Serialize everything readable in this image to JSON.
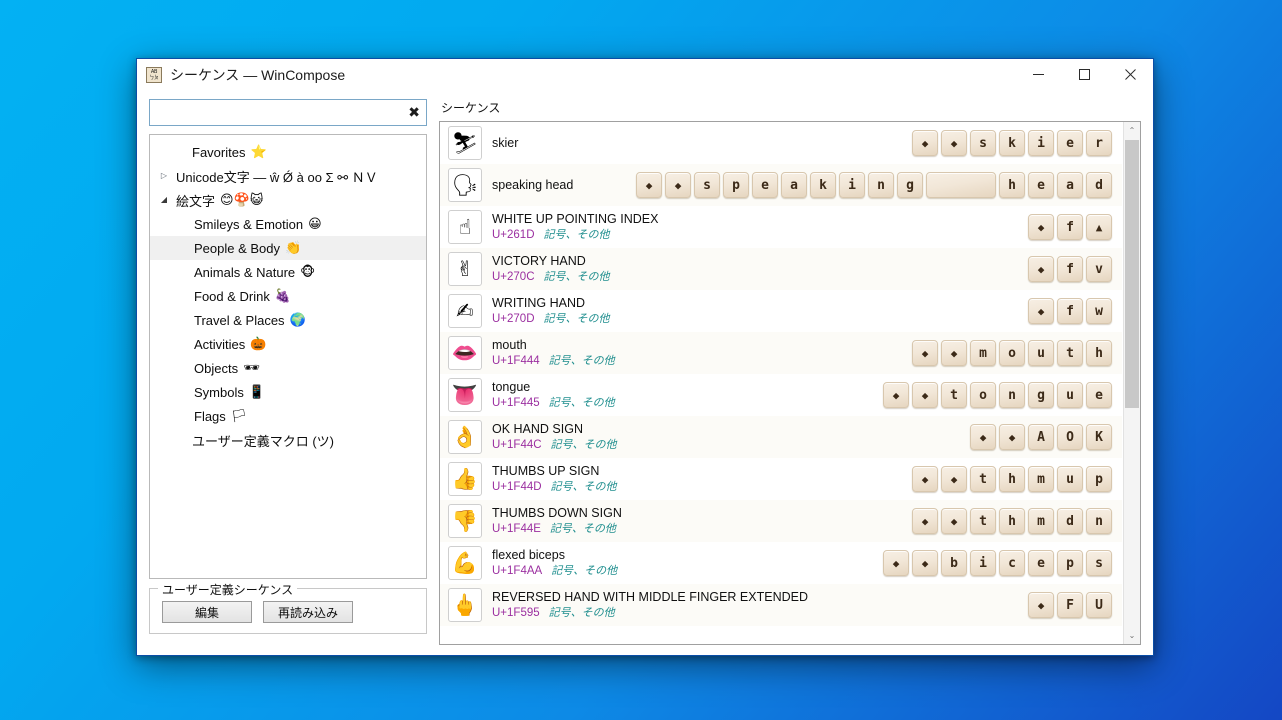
{
  "window": {
    "title": "シーケンス — WinCompose",
    "icon": "app-icon",
    "minimize_label": "—",
    "maximize_label": "☐",
    "close_label": "✕"
  },
  "search": {
    "value": "",
    "placeholder": "",
    "clear_label": "✖"
  },
  "tree": {
    "nodes": [
      {
        "label": "Favorites",
        "emoji": "⭐",
        "twisty": "",
        "indent": "lvl1b",
        "selected": false
      },
      {
        "label": "Unicode文字 — ŵ Ǿ à ᴏᴏ Σ ⚯ ＮＶ",
        "emoji": "",
        "twisty": "▷",
        "indent": "",
        "selected": false
      },
      {
        "label": "絵文字",
        "emoji": "😊🍄😺",
        "twisty": "◢",
        "indent": "",
        "selected": false
      },
      {
        "label": "Smileys & Emotion",
        "emoji": "😀",
        "twisty": "",
        "indent": "lvl2",
        "selected": false
      },
      {
        "label": "People & Body",
        "emoji": "👏",
        "twisty": "",
        "indent": "lvl2",
        "selected": true
      },
      {
        "label": "Animals & Nature",
        "emoji": "🐵",
        "twisty": "",
        "indent": "lvl2",
        "selected": false
      },
      {
        "label": "Food & Drink",
        "emoji": "🍇",
        "twisty": "",
        "indent": "lvl2",
        "selected": false
      },
      {
        "label": "Travel & Places",
        "emoji": "🌍",
        "twisty": "",
        "indent": "lvl2",
        "selected": false
      },
      {
        "label": "Activities",
        "emoji": "🎃",
        "twisty": "",
        "indent": "lvl2",
        "selected": false
      },
      {
        "label": "Objects",
        "emoji": "🕶",
        "twisty": "",
        "indent": "lvl2",
        "selected": false
      },
      {
        "label": "Symbols",
        "emoji": "📱",
        "twisty": "",
        "indent": "lvl2",
        "selected": false
      },
      {
        "label": "Flags",
        "emoji": "🏳",
        "twisty": "",
        "indent": "lvl2",
        "selected": false
      },
      {
        "label": "ユーザー定義マクロ (ツ)",
        "emoji": "",
        "twisty": "",
        "indent": "lvl1b",
        "selected": false
      }
    ]
  },
  "user_sequences": {
    "legend": "ユーザー定義シーケンス",
    "edit_label": "編集",
    "reload_label": "再読み込み"
  },
  "sequences_panel": {
    "label": "シーケンス",
    "rows": [
      {
        "glyph": "⛷",
        "name": "skier",
        "codepoint": "",
        "category": "",
        "keys": [
          "◆",
          "◆",
          "s",
          "k",
          "i",
          "e",
          "r"
        ]
      },
      {
        "glyph": "🗣",
        "name": "speaking head",
        "codepoint": "",
        "category": "",
        "keys": [
          "◆",
          "◆",
          "s",
          "p",
          "e",
          "a",
          "k",
          "i",
          "n",
          "g",
          " ",
          "h",
          "e",
          "a",
          "d"
        ]
      },
      {
        "glyph": "☝",
        "name": "WHITE UP POINTING INDEX",
        "codepoint": "U+261D",
        "category": "記号、その他",
        "keys": [
          "◆",
          "f",
          "▲"
        ]
      },
      {
        "glyph": "✌",
        "name": "VICTORY HAND",
        "codepoint": "U+270C",
        "category": "記号、その他",
        "keys": [
          "◆",
          "f",
          "v"
        ]
      },
      {
        "glyph": "✍",
        "name": "WRITING HAND",
        "codepoint": "U+270D",
        "category": "記号、その他",
        "keys": [
          "◆",
          "f",
          "w"
        ]
      },
      {
        "glyph": "👄",
        "name": "mouth",
        "codepoint": "U+1F444",
        "category": "記号、その他",
        "keys": [
          "◆",
          "◆",
          "m",
          "o",
          "u",
          "t",
          "h"
        ]
      },
      {
        "glyph": "👅",
        "name": "tongue",
        "codepoint": "U+1F445",
        "category": "記号、その他",
        "keys": [
          "◆",
          "◆",
          "t",
          "o",
          "n",
          "g",
          "u",
          "e"
        ]
      },
      {
        "glyph": "👌",
        "name": "OK HAND SIGN",
        "codepoint": "U+1F44C",
        "category": "記号、その他",
        "keys": [
          "◆",
          "◆",
          "A",
          "O",
          "K"
        ]
      },
      {
        "glyph": "👍",
        "name": "THUMBS UP SIGN",
        "codepoint": "U+1F44D",
        "category": "記号、その他",
        "keys": [
          "◆",
          "◆",
          "t",
          "h",
          "m",
          "u",
          "p"
        ]
      },
      {
        "glyph": "👎",
        "name": "THUMBS DOWN SIGN",
        "codepoint": "U+1F44E",
        "category": "記号、その他",
        "keys": [
          "◆",
          "◆",
          "t",
          "h",
          "m",
          "d",
          "n"
        ]
      },
      {
        "glyph": "💪",
        "name": "flexed biceps",
        "codepoint": "U+1F4AA",
        "category": "記号、その他",
        "keys": [
          "◆",
          "◆",
          "b",
          "i",
          "c",
          "e",
          "p",
          "s"
        ]
      },
      {
        "glyph": "🖕",
        "name": "REVERSED HAND WITH MIDDLE FINGER EXTENDED",
        "codepoint": "U+1F595",
        "category": "記号、その他",
        "keys": [
          "◆",
          "F",
          "U"
        ]
      }
    ],
    "scroll_up_label": "⌃",
    "scroll_down_label": "⌄"
  },
  "colors": {
    "codepoint": "#9b2fa0",
    "category": "#1f8e8e",
    "key_face": "#f2e7d8",
    "selection": "#f0f0f0",
    "desktop_top": "#03b1f3",
    "desktop_bottom": "#1447c4"
  }
}
